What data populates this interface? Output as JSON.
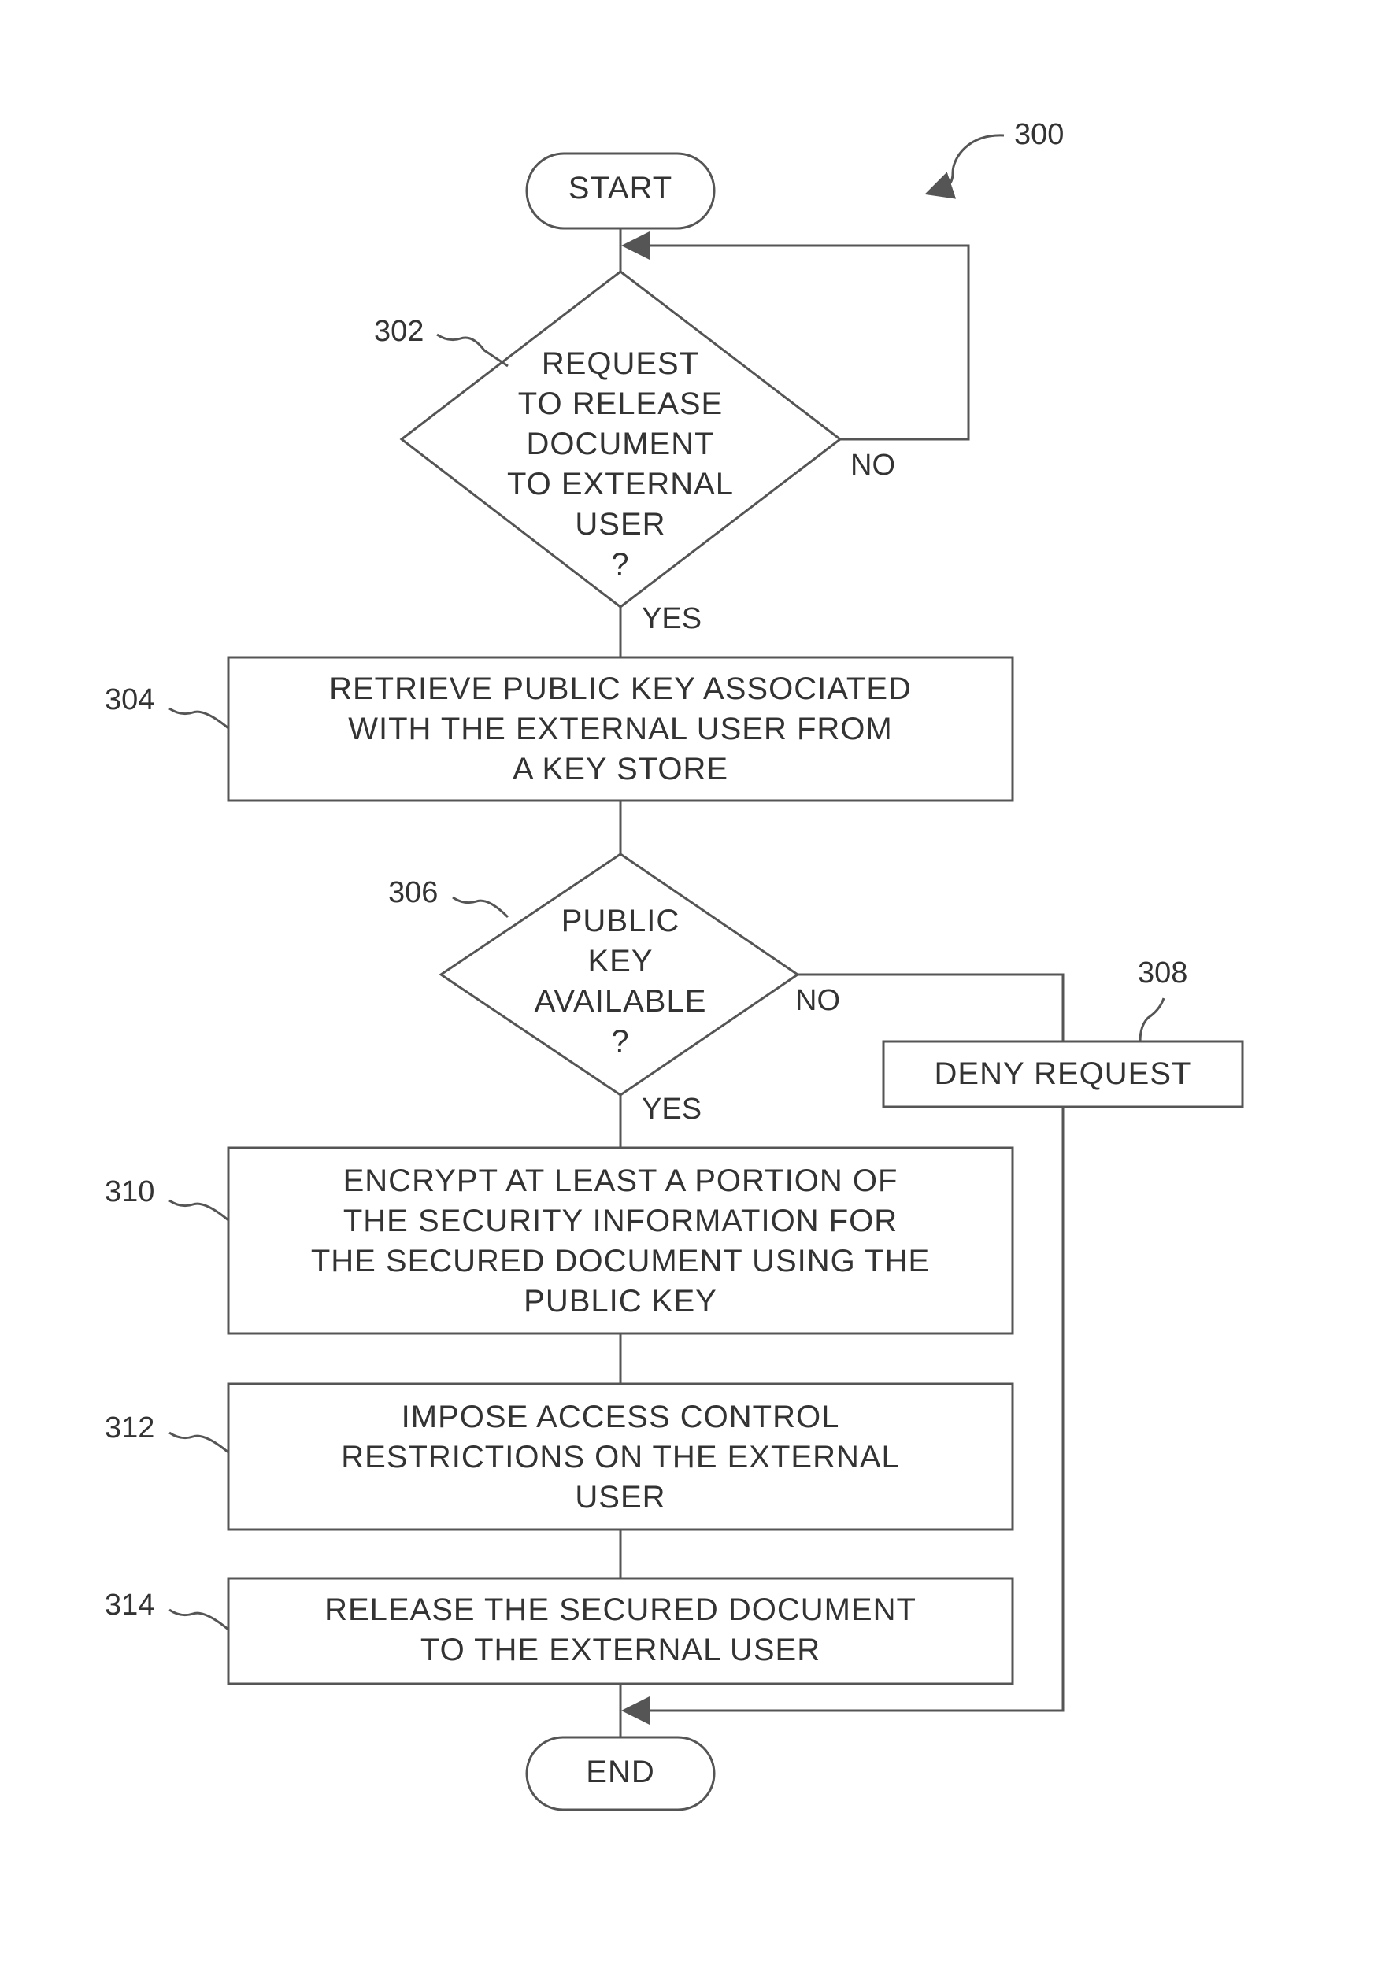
{
  "figure": {
    "ref": "300",
    "start_label": "START",
    "end_label": "END",
    "steps": [
      {
        "ref": "302",
        "type": "decision",
        "text": "REQUEST\nTO RELEASE\nDOCUMENT\nTO EXTERNAL\nUSER\n?",
        "yes": "YES",
        "no": "NO"
      },
      {
        "ref": "304",
        "type": "process",
        "text": "RETRIEVE PUBLIC KEY ASSOCIATED\nWITH THE EXTERNAL USER FROM\nA KEY STORE"
      },
      {
        "ref": "306",
        "type": "decision",
        "text": "PUBLIC\nKEY\nAVAILABLE\n?",
        "yes": "YES",
        "no": "NO"
      },
      {
        "ref": "308",
        "type": "process",
        "text": "DENY REQUEST"
      },
      {
        "ref": "310",
        "type": "process",
        "text": "ENCRYPT AT LEAST A PORTION OF\nTHE SECURITY INFORMATION FOR\nTHE SECURED DOCUMENT USING THE\nPUBLIC KEY"
      },
      {
        "ref": "312",
        "type": "process",
        "text": "IMPOSE ACCESS CONTROL\nRESTRICTIONS ON THE EXTERNAL\nUSER"
      },
      {
        "ref": "314",
        "type": "process",
        "text": "RELEASE THE SECURED DOCUMENT\nTO THE EXTERNAL USER"
      }
    ]
  }
}
